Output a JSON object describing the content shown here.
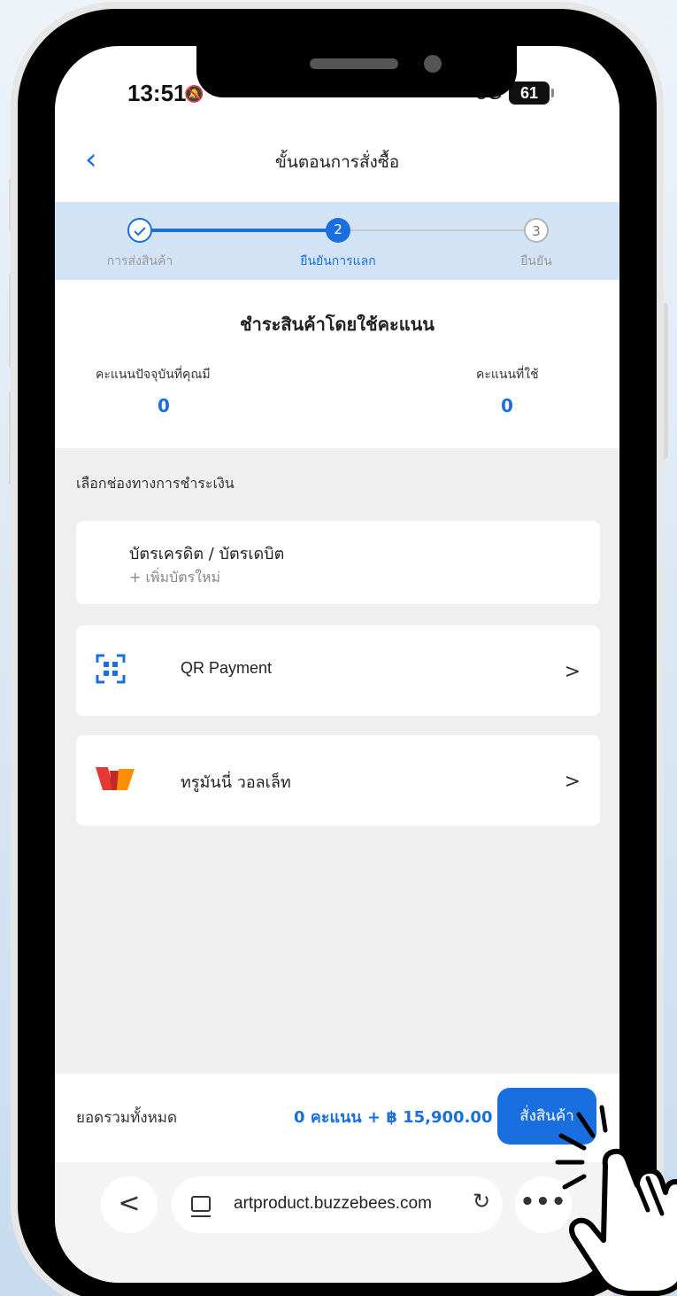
{
  "status_bar": {
    "time": "13:51",
    "network": "5G",
    "battery": "61"
  },
  "nav": {
    "title": "ขั้นตอนการสั่งซื้อ"
  },
  "stepper": {
    "steps": [
      {
        "number": "",
        "label": "การส่งสินค้า",
        "state": "done"
      },
      {
        "number": "2",
        "label": "ยืนยันการแลก",
        "state": "active"
      },
      {
        "number": "3",
        "label": "ยืนยัน",
        "state": "pending"
      }
    ]
  },
  "points": {
    "title": "ชำระสินค้าโดยใช้คะแนน",
    "current_label": "คะแนนปัจจุบันที่คุณมี",
    "current_value": "0",
    "used_label": "คะแนนที่ใช้",
    "used_value": "0"
  },
  "payment": {
    "section_label": "เลือกช่องทางการชำระเงิน",
    "card_title": "บัตรเครดิต / บัตรเดบิต",
    "card_add": "+ เพิ่มบัตรใหม่",
    "qr_label": "QR Payment",
    "wallet_label": "ทรูมันนี่ วอลเล็ท",
    "chevron": ">"
  },
  "footer": {
    "total_label": "ยอดรวมทั้งหมด",
    "total_value": "0 คะแนน + ฿ 15,900.00",
    "order_button": "สั่งสินค้า"
  },
  "browser": {
    "url": "artproduct.buzzebees.com",
    "back": "<",
    "more": "•••"
  },
  "colors": {
    "accent": "#1a6fe0",
    "stepper_bg": "#d3e3f6",
    "wallet_red": "#e53935",
    "wallet_orange": "#ff8f00"
  }
}
